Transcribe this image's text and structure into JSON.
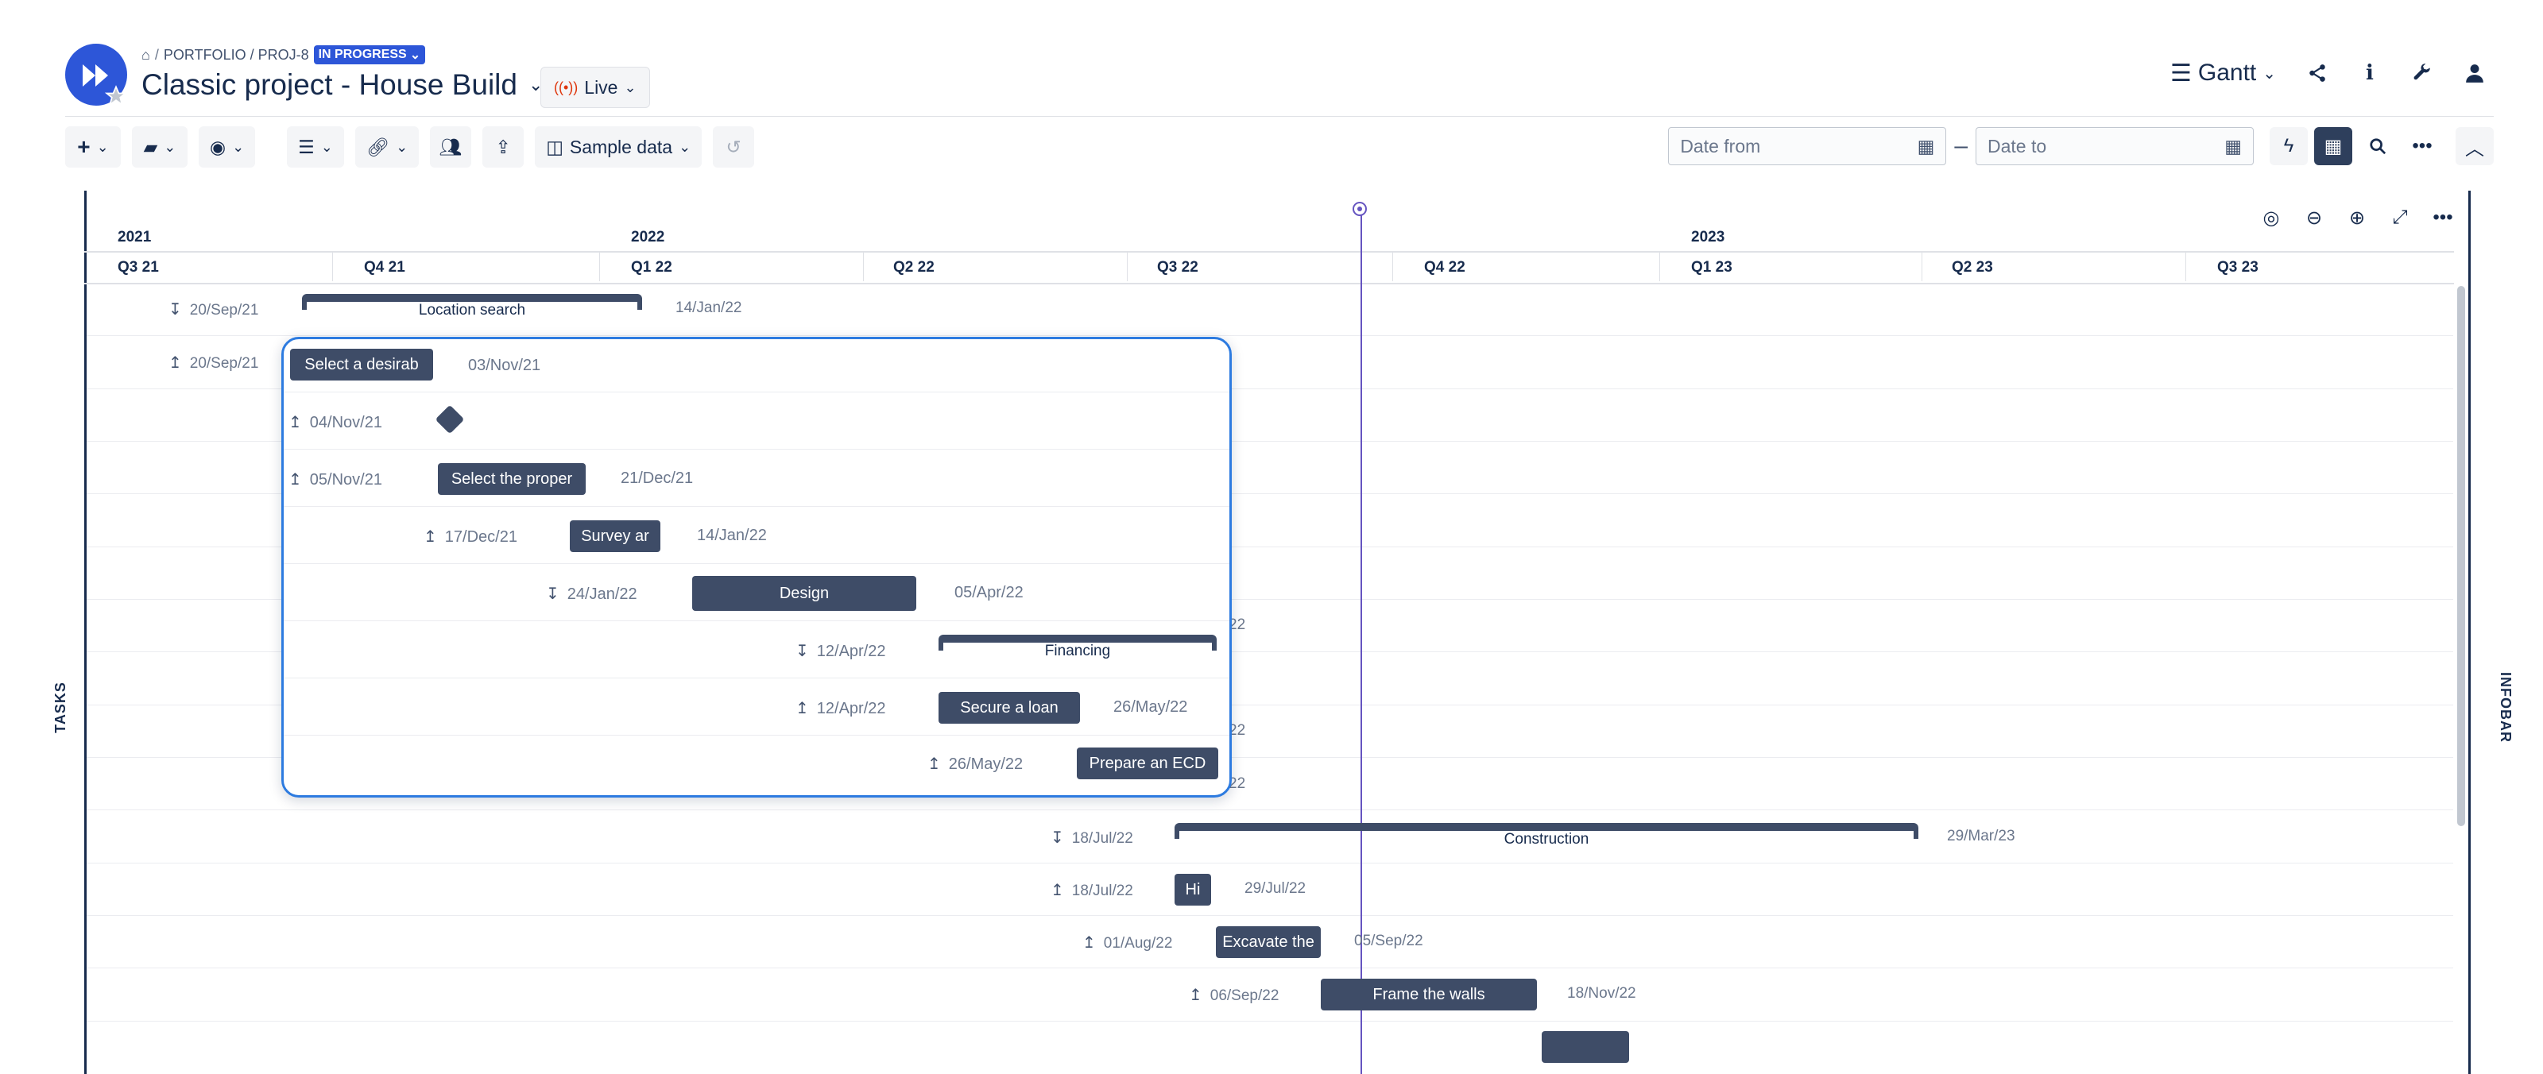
{
  "header": {
    "breadcrumb": {
      "home_icon": "home-icon",
      "path": "PORTFOLIO / PROJ-8",
      "status": "IN PROGRESS"
    },
    "title": "Classic project - House Build",
    "live_label": "Live",
    "view_label": "Gantt"
  },
  "toolbar": {
    "sample_data_label": "Sample data",
    "date_from_placeholder": "Date from",
    "date_to_placeholder": "Date to"
  },
  "gantt": {
    "side_left": "TASKS",
    "side_right": "INFOBAR",
    "years": [
      "2021",
      "2022",
      "2023"
    ],
    "quarters": [
      "Q3 21",
      "Q4 21",
      "Q1 22",
      "Q2 22",
      "Q3 22",
      "Q4 22",
      "Q1 23",
      "Q2 23",
      "Q3 23"
    ],
    "rows": [
      {
        "start": "20/Sep/21",
        "label": "Location search",
        "end": "14/Jan/22"
      },
      {
        "start": "20/Sep/21"
      },
      {
        "end": "22",
        "note": "partially hidden"
      },
      {
        "end": "22"
      },
      {
        "end": "22"
      },
      {
        "start": "18/Jul/22",
        "label": "Construction",
        "end": "29/Mar/23"
      },
      {
        "start": "18/Jul/22",
        "label": "Hi",
        "end": "29/Jul/22"
      },
      {
        "start": "01/Aug/22",
        "label": "Excavate the",
        "end": "05/Sep/22"
      },
      {
        "start": "06/Sep/22",
        "label": "Frame the walls",
        "end": "18/Nov/22"
      }
    ]
  },
  "popup": {
    "rows": [
      {
        "label": "Select a desirab",
        "end": "03/Nov/21"
      },
      {
        "start": "04/Nov/21"
      },
      {
        "start": "05/Nov/21",
        "label": "Select the proper",
        "end": "21/Dec/21"
      },
      {
        "start": "17/Dec/21",
        "label": "Survey ar",
        "end": "14/Jan/22"
      },
      {
        "start": "24/Jan/22",
        "label": "Design",
        "end": "05/Apr/22"
      },
      {
        "start": "12/Apr/22",
        "label": "Financing"
      },
      {
        "start": "12/Apr/22",
        "label": "Secure a loan",
        "end": "26/May/22"
      },
      {
        "start": "26/May/22",
        "label": "Prepare an ECD"
      }
    ]
  }
}
